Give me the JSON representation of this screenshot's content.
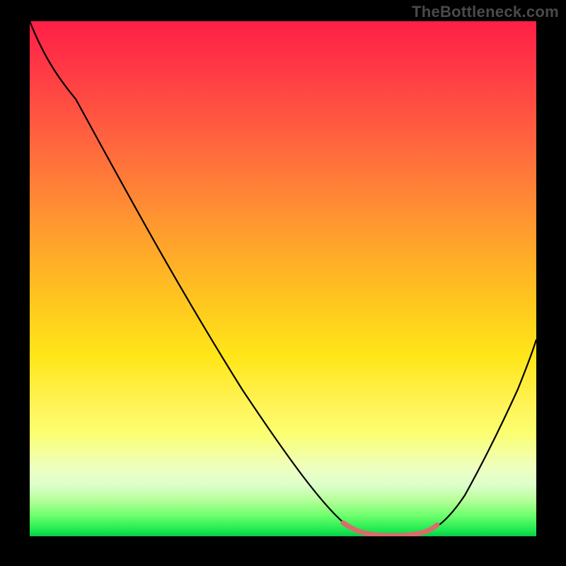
{
  "watermark": "TheBottleneck.com",
  "colors": {
    "background": "#000000",
    "watermark": "#4a4a4a",
    "curve": "#000000",
    "highlight": "#d86d6b",
    "gradient_top": "#ff1f47",
    "gradient_bottom": "#0cc94a"
  },
  "chart_data": {
    "type": "line",
    "title": "",
    "xlabel": "",
    "ylabel": "",
    "xlim": [
      0,
      100
    ],
    "ylim": [
      0,
      100
    ],
    "x": [
      0,
      5,
      10,
      15,
      20,
      25,
      30,
      35,
      40,
      45,
      50,
      55,
      60,
      62,
      65,
      68,
      72,
      76,
      80,
      84,
      88,
      92,
      96,
      100
    ],
    "series": [
      {
        "name": "bottleneck-curve",
        "values": [
          100,
          94,
          87,
          80,
          72,
          64,
          56,
          48,
          40,
          32,
          24,
          16,
          9,
          5,
          2,
          1,
          0,
          0,
          2,
          7,
          14,
          22,
          30,
          38
        ]
      }
    ],
    "highlight_range_x": [
      62,
      78
    ],
    "gradient_meaning": "top=red=high bottleneck, bottom=green=low bottleneck",
    "grid": false,
    "legend": false
  }
}
